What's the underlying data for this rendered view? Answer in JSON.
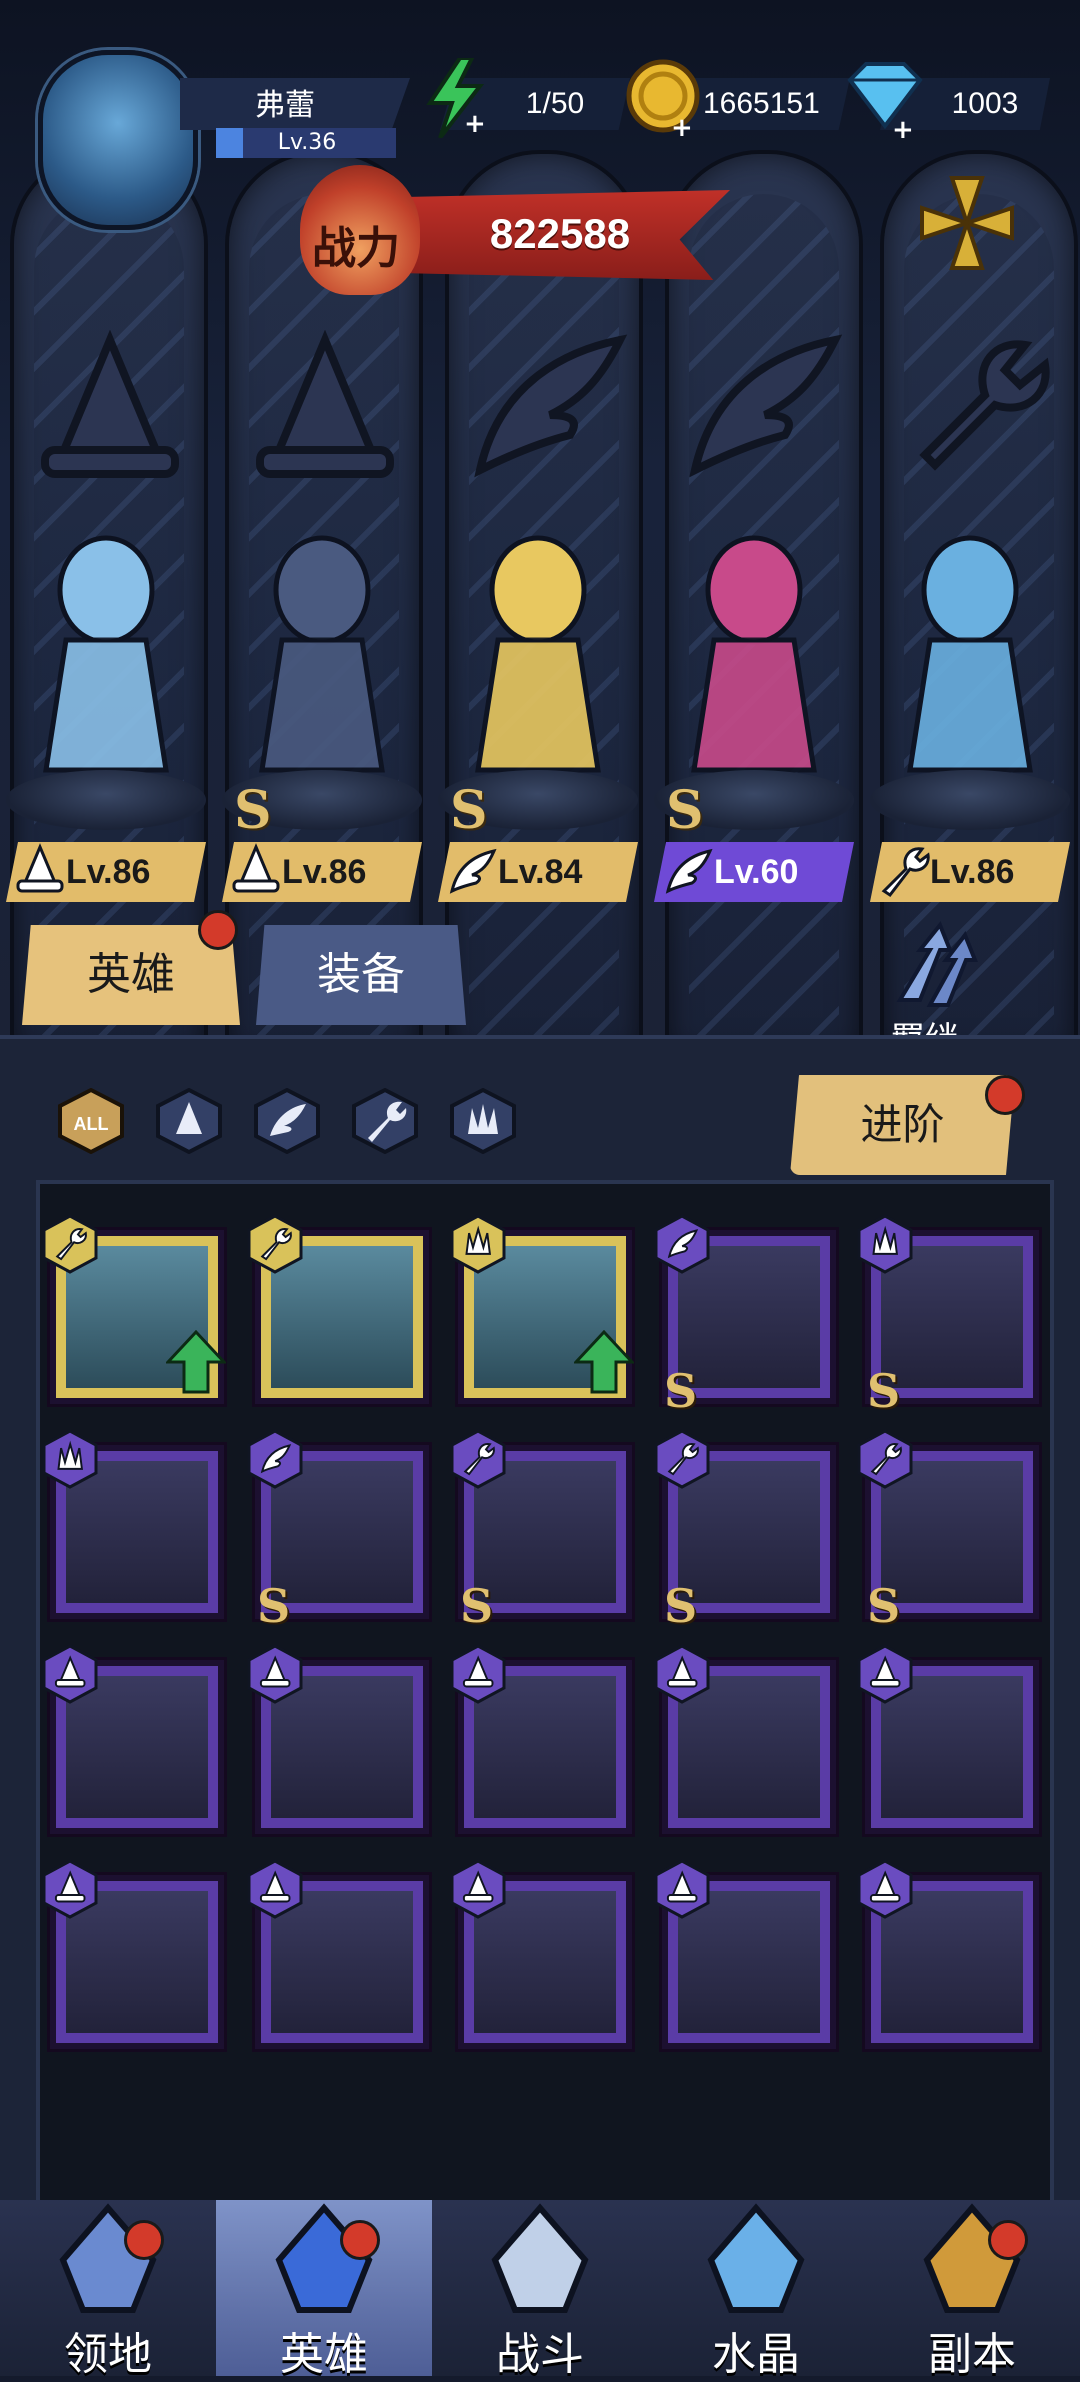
{
  "player": {
    "name": "弗蕾",
    "level": "Lv.36",
    "level_progress": 0.15
  },
  "resources": [
    {
      "icon": "energy-icon",
      "value": "1/50"
    },
    {
      "icon": "gold-coin-icon",
      "value": "1665151"
    },
    {
      "icon": "diamond-icon",
      "value": "1003"
    }
  ],
  "power": {
    "label": "战力",
    "value": "822588"
  },
  "lineup": [
    {
      "class": "mage-hat-icon",
      "level": "Lv.86",
      "rank": "",
      "tag": "gold"
    },
    {
      "class": "mage-hat-icon",
      "level": "Lv.86",
      "rank": "S",
      "tag": "gold"
    },
    {
      "class": "wing-icon",
      "level": "Lv.84",
      "rank": "S",
      "tag": "gold"
    },
    {
      "class": "wing-icon",
      "level": "Lv.60",
      "rank": "S",
      "tag": "purple"
    },
    {
      "class": "wrench-icon",
      "level": "Lv.86",
      "rank": "",
      "tag": "gold"
    }
  ],
  "tabs": {
    "heroes": "英雄",
    "equipment": "装备"
  },
  "bond": {
    "label": "羁绊"
  },
  "filters": {
    "all": "ALL"
  },
  "advance": {
    "label": "进阶"
  },
  "roster": [
    {
      "class": "wrench-icon",
      "frame": "gold",
      "rank": "",
      "upgrade": true
    },
    {
      "class": "wrench-icon",
      "frame": "gold",
      "rank": "",
      "upgrade": false
    },
    {
      "class": "claw-icon",
      "frame": "gold",
      "rank": "",
      "upgrade": true
    },
    {
      "class": "wing-icon",
      "frame": "purple",
      "rank": "S",
      "upgrade": false
    },
    {
      "class": "claw-icon",
      "frame": "purple",
      "rank": "S",
      "upgrade": false
    },
    {
      "class": "claw-icon",
      "frame": "purple",
      "rank": "",
      "upgrade": false
    },
    {
      "class": "wing-icon",
      "frame": "purple",
      "rank": "S",
      "upgrade": false
    },
    {
      "class": "wrench-icon",
      "frame": "purple",
      "rank": "S",
      "upgrade": false
    },
    {
      "class": "wrench-icon",
      "frame": "purple",
      "rank": "S",
      "upgrade": false
    },
    {
      "class": "wrench-icon",
      "frame": "purple",
      "rank": "S",
      "upgrade": false
    },
    {
      "class": "mage-hat-icon",
      "frame": "purple",
      "rank": "",
      "upgrade": false
    },
    {
      "class": "mage-hat-icon",
      "frame": "purple",
      "rank": "",
      "upgrade": false
    },
    {
      "class": "mage-hat-icon",
      "frame": "purple",
      "rank": "",
      "upgrade": false
    },
    {
      "class": "mage-hat-icon",
      "frame": "purple",
      "rank": "",
      "upgrade": false
    },
    {
      "class": "mage-hat-icon",
      "frame": "purple",
      "rank": "",
      "upgrade": false
    },
    {
      "class": "mage-hat-icon",
      "frame": "purple",
      "rank": "",
      "upgrade": false
    },
    {
      "class": "mage-hat-icon",
      "frame": "purple",
      "rank": "",
      "upgrade": false
    },
    {
      "class": "mage-hat-icon",
      "frame": "purple",
      "rank": "",
      "upgrade": false
    },
    {
      "class": "mage-hat-icon",
      "frame": "purple",
      "rank": "",
      "upgrade": false
    },
    {
      "class": "mage-hat-icon",
      "frame": "purple",
      "rank": "",
      "upgrade": false
    }
  ],
  "nav": [
    {
      "label": "领地",
      "icon": "territory-icon",
      "badge": true,
      "active": false
    },
    {
      "label": "英雄",
      "icon": "hero-hat-icon",
      "badge": true,
      "active": true
    },
    {
      "label": "战斗",
      "icon": "battle-sword-icon",
      "badge": false,
      "active": false
    },
    {
      "label": "水晶",
      "icon": "crystal-icon",
      "badge": false,
      "active": false
    },
    {
      "label": "副本",
      "icon": "dungeon-portal-icon",
      "badge": true,
      "active": false
    }
  ],
  "colors": {
    "gold": "#e2bc6a",
    "purple": "#6f4ad6",
    "red": "#d33a2a",
    "panel": "#1c2438"
  }
}
